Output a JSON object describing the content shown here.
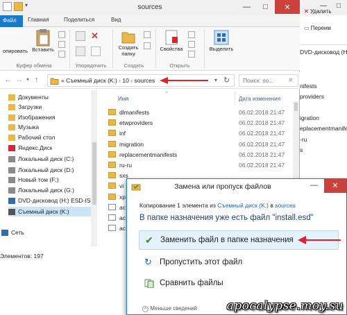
{
  "explorer": {
    "title": "sources",
    "tabs": {
      "file": "Файл",
      "home": "Главная",
      "share": "Поделиться",
      "view": "Вид"
    },
    "ribbon": {
      "copy_partial": "опировать",
      "paste": "Вставить",
      "clipboard_group": "Буфер обмена",
      "organize_group": "Упорядочить",
      "new_folder": "Создать\nпапку",
      "create_group": "Создать",
      "properties": "Свойства",
      "open_group": "Открыть",
      "select": "Выделить"
    },
    "address": {
      "prefix": "«",
      "crumbs": [
        "Съемный диск (K:)",
        "10",
        "sources"
      ],
      "search_placeholder": "Поиск: so..."
    },
    "columns": {
      "name": "Имя",
      "date": "Дата изменения"
    },
    "nav_items": [
      {
        "label": "Документы",
        "icon": "documents-icon"
      },
      {
        "label": "Загрузки",
        "icon": "downloads-icon"
      },
      {
        "label": "Изображения",
        "icon": "pictures-icon"
      },
      {
        "label": "Музыка",
        "icon": "music-icon"
      },
      {
        "label": "Рабочий стол",
        "icon": "desktop-icon"
      },
      {
        "label": "Яндекс.Диск",
        "icon": "yandex-disk-icon"
      },
      {
        "label": "Локальный диск (C:)",
        "icon": "drive-icon"
      },
      {
        "label": "Локальный диск (D:)",
        "icon": "drive-icon"
      },
      {
        "label": "Новый том (F:)",
        "icon": "drive-icon"
      },
      {
        "label": "Локальный диск (G:)",
        "icon": "drive-icon"
      },
      {
        "label": "DVD-дисковод (H:) ESD-ISO",
        "icon": "dvd-icon"
      },
      {
        "label": "Съемный диск (K:)",
        "icon": "usb-drive-icon"
      },
      {
        "label": "Сеть",
        "icon": "network-icon"
      }
    ],
    "files": [
      {
        "name": "dlmanifests",
        "date": "06.02.2018 21:47"
      },
      {
        "name": "etwproviders",
        "date": "06.02.2018 21:47"
      },
      {
        "name": "inf",
        "date": "06.02.2018 21:47"
      },
      {
        "name": "migration",
        "date": "06.02.2018 21:47"
      },
      {
        "name": "replacementmanifests",
        "date": "06.02.2018 21:47"
      },
      {
        "name": "ru-ru",
        "date": "06.02.2018 21:47"
      },
      {
        "name": "sxs",
        "date": ""
      },
      {
        "name": "vi",
        "date": ""
      },
      {
        "name": "xp",
        "date": ""
      },
      {
        "name": "ac",
        "date": ""
      },
      {
        "name": "ac",
        "date": ""
      },
      {
        "name": "ac",
        "date": ""
      }
    ],
    "status": "Элементов: 197"
  },
  "right_window": {
    "delete": "Удалить",
    "rename": "Переим",
    "dvd": "DVD-дисковод (H:) ES",
    "items": [
      "nifests",
      "providers",
      "",
      "igration",
      "eplacementmanifest",
      "-ru",
      "s"
    ]
  },
  "dialog": {
    "title": "Замена или пропуск файлов",
    "copy_prefix": "Копирование 1 элемента из",
    "copy_source": "Съемный диск (K:)",
    "copy_mid": "в",
    "copy_dest": "sources",
    "message": "В папке назначения уже есть файл \"install.esd\"",
    "options": {
      "replace": "Заменить файл в папке назначения",
      "skip": "Пропустить этот файл",
      "compare": "Сравнить файлы"
    },
    "less_details": "Меньше сведений"
  },
  "watermark": "apocalypse.moy.su",
  "colors": {
    "accent": "#1979ca",
    "folder": "#e8b84a",
    "arrow": "#e0212a",
    "close": "#c9423c"
  }
}
